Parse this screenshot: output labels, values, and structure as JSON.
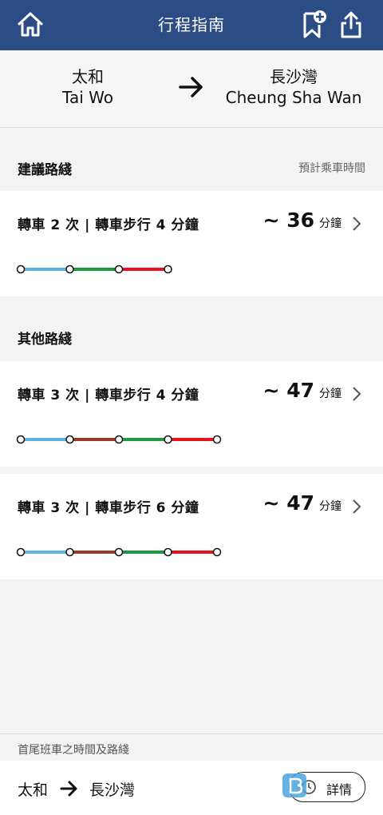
{
  "header": {
    "title": "行程指南",
    "home_icon": "home-icon",
    "bookmark_icon": "bookmark-add-icon",
    "share_icon": "share-icon"
  },
  "route": {
    "from_zh": "太和",
    "from_en": "Tai Wo",
    "to_zh": "長沙灣",
    "to_en": "Cheung Sha Wan"
  },
  "suggested": {
    "label": "建議路綫",
    "time_label": "預計乘車時間",
    "routes": [
      {
        "desc": "轉車 2 次 | 轉車步行 4 分鐘",
        "time": "~ 36",
        "unit": "分鐘",
        "segments": [
          "#5bb3e3",
          "#1c9a3e",
          "#e8121d"
        ]
      }
    ]
  },
  "other": {
    "label": "其他路綫",
    "routes": [
      {
        "desc": "轉車 3 次 | 轉車步行 4 分鐘",
        "time": "~ 47",
        "unit": "分鐘",
        "segments": [
          "#5bb3e3",
          "#9a3c24",
          "#1c9a3e",
          "#e8121d"
        ]
      },
      {
        "desc": "轉車 3 次 | 轉車步行 6 分鐘",
        "time": "~ 47",
        "unit": "分鐘",
        "segments": [
          "#5bb3e3",
          "#9a3c24",
          "#1c9a3e",
          "#e8121d"
        ]
      }
    ]
  },
  "footer": {
    "label": "首尾班車之時間及路綫",
    "from": "太和",
    "to": "長沙灣",
    "details_label": "詳情"
  },
  "colors": {
    "header_bg": "#2c4c86",
    "east_rail": "#5bb3e3",
    "tuen_ma": "#9a3c24",
    "kwun_tong": "#1c9a3e",
    "tsuen_wan": "#e8121d"
  }
}
